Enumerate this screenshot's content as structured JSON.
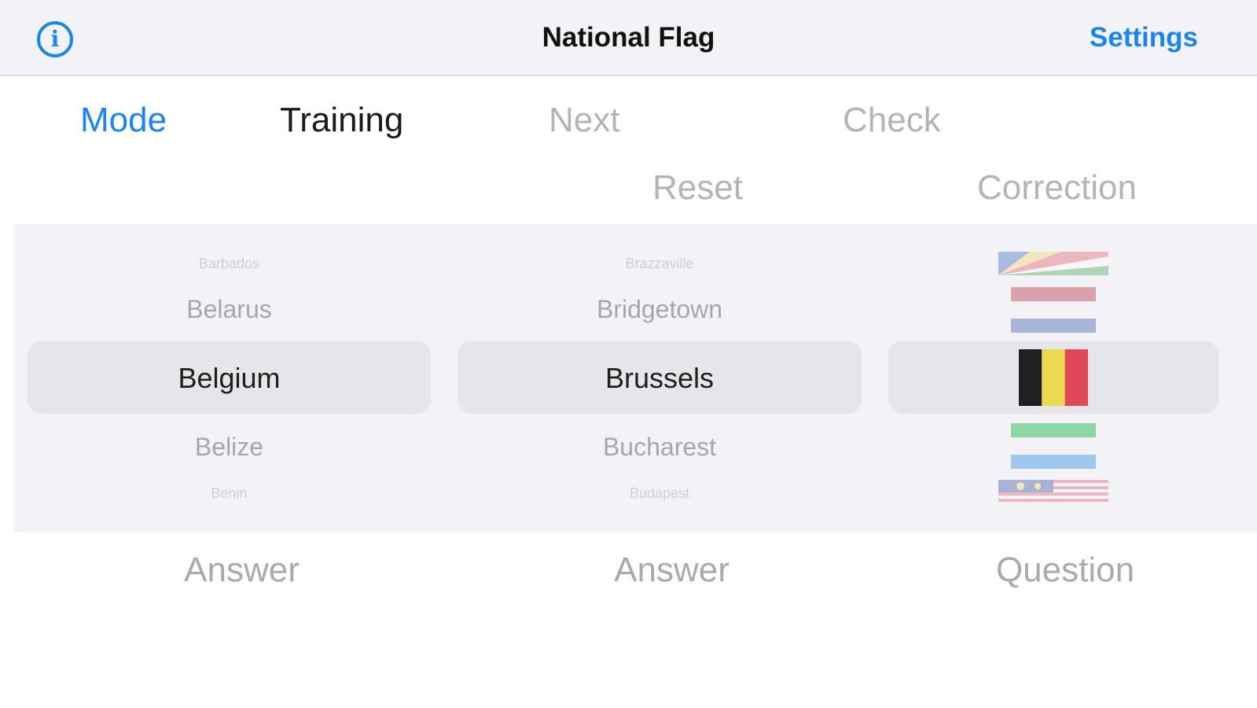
{
  "navbar": {
    "title": "National Flag",
    "settings_label": "Settings",
    "info_glyph": "i"
  },
  "toolbar": {
    "mode_label": "Mode",
    "training_label": "Training",
    "next_label": "Next",
    "check_label": "Check",
    "reset_label": "Reset",
    "correction_label": "Correction"
  },
  "picker": {
    "countries": {
      "items": [
        "Barbados",
        "Belarus",
        "Belgium",
        "Belize",
        "Benin"
      ],
      "selected": "Belgium"
    },
    "capitals": {
      "items": [
        "Brazzaville",
        "Bridgetown",
        "Brussels",
        "Bucharest",
        "Budapest"
      ],
      "selected": "Brussels"
    },
    "flags": {
      "items": [
        "seychelles-flag",
        "partial-red-white-blue-flag",
        "belgium-flag",
        "partial-green-white-blue-flag",
        "malaysia-flag"
      ],
      "selected": "belgium-flag",
      "belgium_colors": [
        "#202020",
        "#ecd94f",
        "#e0485a"
      ]
    }
  },
  "column_labels": {
    "col1": "Answer",
    "col2": "Answer",
    "col3": "Question"
  },
  "colors": {
    "accent": "#1a84f0"
  }
}
